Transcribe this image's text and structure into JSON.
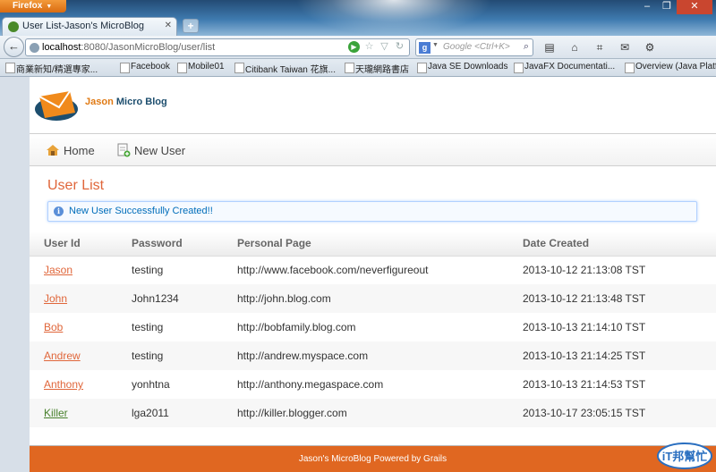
{
  "browser": {
    "app_button": "Firefox",
    "tab_title": "User List-Jason's MicroBlog",
    "url_host": "localhost",
    "url_path": ":8080/JasonMicroBlog/user/list",
    "search_placeholder": "Google <Ctrl+K>",
    "bookmarks": [
      "商業新知/精選專家...",
      "Facebook",
      "Mobile01",
      "Citibank Taiwan 花旗...",
      "天瓏網路書店",
      "Java SE Downloads",
      "JavaFX Documentati...",
      "Overview (Java Platf..."
    ]
  },
  "site": {
    "logo_part1": "Jason",
    "logo_part2": " Micro Blog",
    "menu": {
      "home": "Home",
      "new_user": "New User"
    }
  },
  "main": {
    "title": "User List",
    "message": "New User Successfully Created!!",
    "columns": [
      "User Id",
      "Password",
      "Personal Page",
      "Date Created"
    ],
    "rows": [
      [
        "Jason",
        "testing",
        "http://www.facebook.com/neverfigureout",
        "2013-10-12 21:13:08 TST"
      ],
      [
        "John",
        "John1234",
        "http://john.blog.com",
        "2013-10-12 21:13:48 TST"
      ],
      [
        "Bob",
        "testing",
        "http://bobfamily.blog.com",
        "2013-10-13 21:14:10 TST"
      ],
      [
        "Andrew",
        "testing",
        "http://andrew.myspace.com",
        "2013-10-13 21:14:25 TST"
      ],
      [
        "Anthony",
        "yonhtna",
        "http://anthony.megaspace.com",
        "2013-10-13 21:14:53 TST"
      ],
      [
        "Killer",
        "lga2011",
        "http://killer.blogger.com",
        "2013-10-17 23:05:15 TST"
      ]
    ]
  },
  "footer": {
    "text": "Jason's MicroBlog Powered by Grails"
  },
  "watermark": {
    "text": "iT邦幫忙"
  },
  "colors": {
    "accent": "#e0663a",
    "footer": "#e06721",
    "message": "#006dba",
    "visited": "#48802c"
  }
}
